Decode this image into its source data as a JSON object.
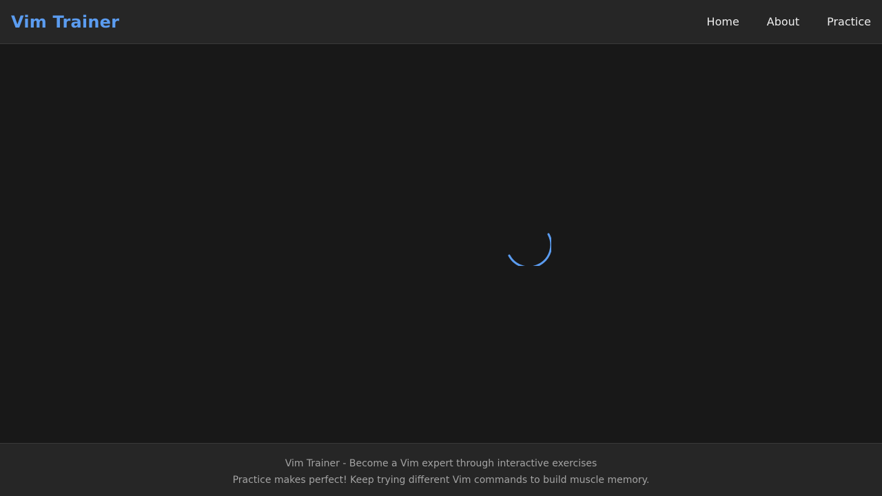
{
  "header": {
    "brand": "Vim Trainer",
    "nav": [
      {
        "label": "Home"
      },
      {
        "label": "About"
      },
      {
        "label": "Practice"
      }
    ]
  },
  "main": {
    "state": "loading",
    "spinner_icon": "loading-spinner-icon"
  },
  "footer": {
    "line1": "Vim Trainer - Become a Vim expert through interactive exercises",
    "line2": "Practice makes perfect! Keep trying different Vim commands to build muscle memory."
  },
  "colors": {
    "accent": "#5b9cf0",
    "background": "#181818",
    "surface": "#262626",
    "text": "#ececec",
    "muted_text": "#a3a3a3"
  }
}
